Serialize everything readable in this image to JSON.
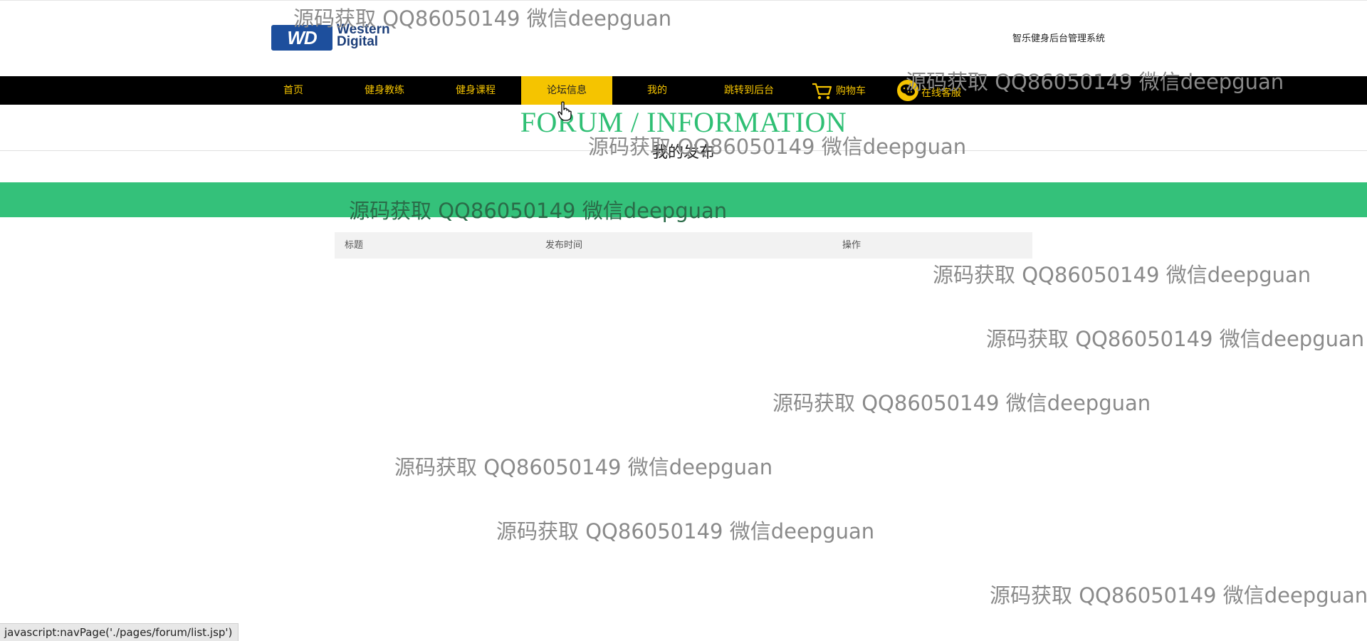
{
  "header": {
    "logo_line1": "Western",
    "logo_line2": "Digital",
    "logo_badge": "WD",
    "system_title": "智乐健身后台管理系统"
  },
  "nav": {
    "items": [
      {
        "label": "首页"
      },
      {
        "label": "健身教练"
      },
      {
        "label": "健身课程"
      },
      {
        "label": "论坛信息"
      },
      {
        "label": "我的"
      },
      {
        "label": "跳转到后台"
      },
      {
        "label": "购物车"
      },
      {
        "label": "在线客服"
      }
    ],
    "active": "论坛信息"
  },
  "forum": {
    "title_en": "FORUM / INFORMATION",
    "subtitle": "我的发布"
  },
  "table": {
    "columns": [
      "标题",
      "发布时间",
      "操作"
    ],
    "rows": []
  },
  "watermark_text": "源码获取 QQ86050149 微信deepguan",
  "status_bar": "javascript:navPage('./pages/forum/list.jsp')",
  "colors": {
    "nav_bg": "#000000",
    "nav_text": "#f5c400",
    "accent_green": "#34c17a",
    "title_green": "#2fbf74"
  }
}
